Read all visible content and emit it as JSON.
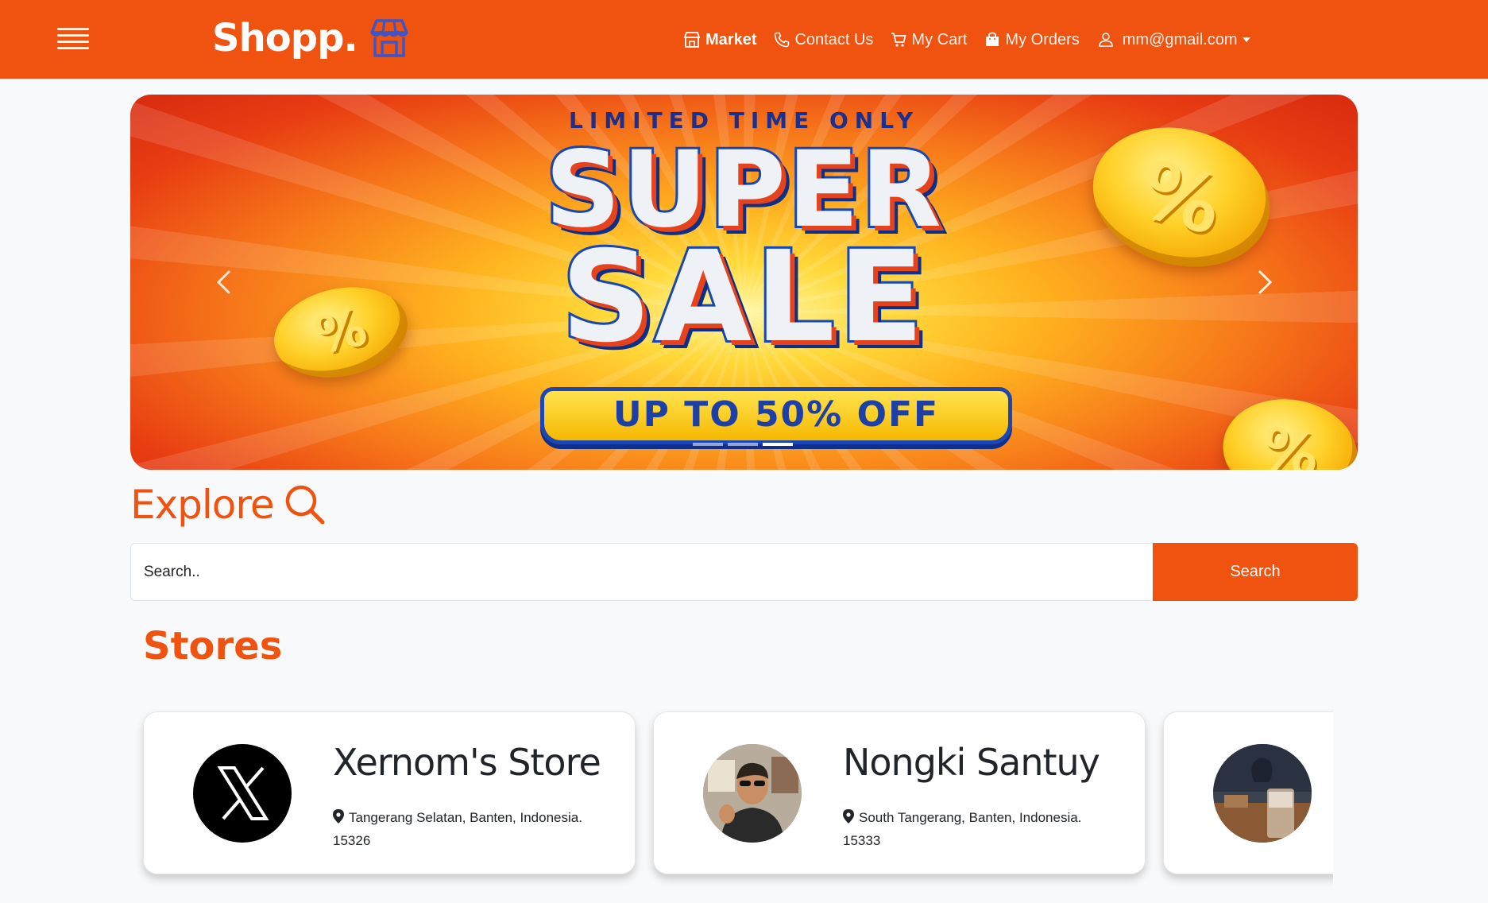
{
  "navbar": {
    "brand": "Shopp.",
    "links": {
      "market": "Market",
      "contact": "Contact Us",
      "cart": "My Cart",
      "orders": "My Orders",
      "user": "mm@gmail.com"
    }
  },
  "banner": {
    "top_text": "LIMITED TIME ONLY",
    "line1": "SUPER",
    "line2": "SALE",
    "pill": "UP TO 50% OFF",
    "coin_symbol": "%",
    "active_slide": 3,
    "slide_count": 3
  },
  "explore": {
    "title": "Explore",
    "search_placeholder": "Search..",
    "search_button": "Search"
  },
  "stores": {
    "title": "Stores",
    "items": [
      {
        "name": "Xernom's Store",
        "address": "Tangerang Selatan, Banten, Indonesia. 15326",
        "avatar": "x-logo"
      },
      {
        "name": "Nongki Santuy",
        "address": "South Tangerang, Banten, Indonesia. 15333",
        "avatar": "person-photo"
      },
      {
        "name": "",
        "address": "",
        "avatar": "cafe-photo"
      }
    ]
  },
  "colors": {
    "brand_orange": "#f0520f",
    "background": "#f8f9fa"
  }
}
